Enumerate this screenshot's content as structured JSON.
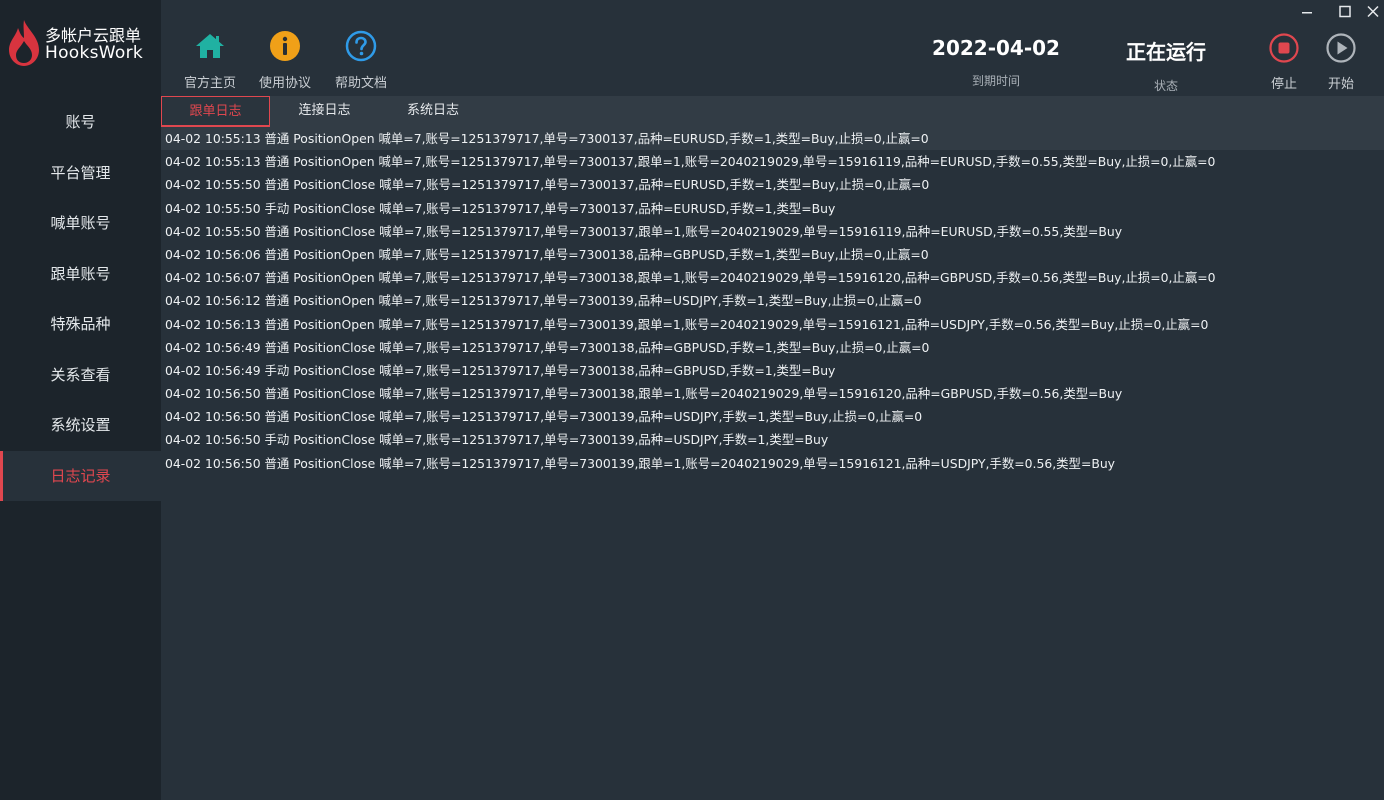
{
  "app": {
    "title_cn": "多帐户云跟单",
    "title_en": "HooksWork",
    "accent": "#e0474f"
  },
  "sidebar": {
    "items": [
      {
        "label": "账号",
        "name": "sidebar-item-account"
      },
      {
        "label": "平台管理",
        "name": "sidebar-item-platform"
      },
      {
        "label": "喊单账号",
        "name": "sidebar-item-signal-account"
      },
      {
        "label": "跟单账号",
        "name": "sidebar-item-follow-account"
      },
      {
        "label": "特殊品种",
        "name": "sidebar-item-special-symbols"
      },
      {
        "label": "关系查看",
        "name": "sidebar-item-relations"
      },
      {
        "label": "系统设置",
        "name": "sidebar-item-settings"
      },
      {
        "label": "日志记录",
        "name": "sidebar-item-logs"
      }
    ],
    "active_index": 7
  },
  "toolbar": {
    "home_label": "官方主页",
    "home_icon": "home-icon",
    "agreement_label": "使用协议",
    "agreement_icon": "info-icon",
    "help_label": "帮助文档",
    "help_icon": "help-icon"
  },
  "status": {
    "expire_date": "2022-04-02",
    "expire_label": "到期时间",
    "state_value": "正在运行",
    "state_label": "状态"
  },
  "controls": {
    "stop_label": "停止",
    "start_label": "开始",
    "stop_color": "#e0474f",
    "start_color": "#aeb4ba"
  },
  "tabs": [
    {
      "label": "跟单日志",
      "active": true
    },
    {
      "label": "连接日志",
      "active": false
    },
    {
      "label": "系统日志",
      "active": false
    }
  ],
  "logs": [
    "04-02 10:55:13 普通 PositionOpen 喊单=7,账号=1251379717,单号=7300137,品种=EURUSD,手数=1,类型=Buy,止损=0,止赢=0",
    "04-02 10:55:13 普通 PositionOpen 喊单=7,账号=1251379717,单号=7300137,跟单=1,账号=2040219029,单号=15916119,品种=EURUSD,手数=0.55,类型=Buy,止损=0,止赢=0",
    "04-02 10:55:50 普通 PositionClose 喊单=7,账号=1251379717,单号=7300137,品种=EURUSD,手数=1,类型=Buy,止损=0,止赢=0",
    "04-02 10:55:50 手动 PositionClose 喊单=7,账号=1251379717,单号=7300137,品种=EURUSD,手数=1,类型=Buy",
    "04-02 10:55:50 普通 PositionClose 喊单=7,账号=1251379717,单号=7300137,跟单=1,账号=2040219029,单号=15916119,品种=EURUSD,手数=0.55,类型=Buy",
    "04-02 10:56:06 普通 PositionOpen 喊单=7,账号=1251379717,单号=7300138,品种=GBPUSD,手数=1,类型=Buy,止损=0,止赢=0",
    "04-02 10:56:07 普通 PositionOpen 喊单=7,账号=1251379717,单号=7300138,跟单=1,账号=2040219029,单号=15916120,品种=GBPUSD,手数=0.56,类型=Buy,止损=0,止赢=0",
    "04-02 10:56:12 普通 PositionOpen 喊单=7,账号=1251379717,单号=7300139,品种=USDJPY,手数=1,类型=Buy,止损=0,止赢=0",
    "04-02 10:56:13 普通 PositionOpen 喊单=7,账号=1251379717,单号=7300139,跟单=1,账号=2040219029,单号=15916121,品种=USDJPY,手数=0.56,类型=Buy,止损=0,止赢=0",
    "04-02 10:56:49 普通 PositionClose 喊单=7,账号=1251379717,单号=7300138,品种=GBPUSD,手数=1,类型=Buy,止损=0,止赢=0",
    "04-02 10:56:49 手动 PositionClose 喊单=7,账号=1251379717,单号=7300138,品种=GBPUSD,手数=1,类型=Buy",
    "04-02 10:56:50 普通 PositionClose 喊单=7,账号=1251379717,单号=7300138,跟单=1,账号=2040219029,单号=15916120,品种=GBPUSD,手数=0.56,类型=Buy",
    "04-02 10:56:50 普通 PositionClose 喊单=7,账号=1251379717,单号=7300139,品种=USDJPY,手数=1,类型=Buy,止损=0,止赢=0",
    "04-02 10:56:50 手动 PositionClose 喊单=7,账号=1251379717,单号=7300139,品种=USDJPY,手数=1,类型=Buy",
    "04-02 10:56:50 普通 PositionClose 喊单=7,账号=1251379717,单号=7300139,跟单=1,账号=2040219029,单号=15916121,品种=USDJPY,手数=0.56,类型=Buy"
  ],
  "selected_log_index": 0
}
